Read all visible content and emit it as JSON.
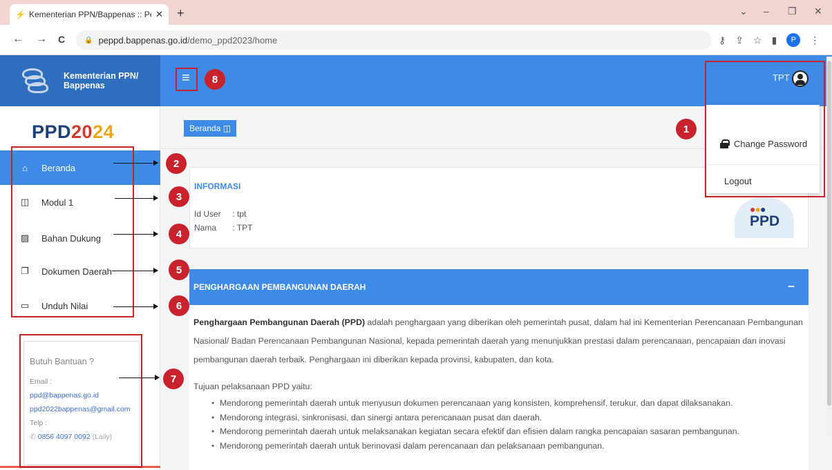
{
  "browser": {
    "tab_title": "Kementerian PPN/Bappenas :: Pe",
    "tab_close": "✕",
    "new_tab": "+",
    "url_domain": "peppd.bappenas.go.id",
    "url_path": "/demo_ppd2023/home",
    "profile_initial": "P",
    "controls": {
      "minimize": "–",
      "restore": "❐",
      "close": "✕",
      "chevron": "⌄"
    },
    "nav": {
      "back": "←",
      "forward": "→",
      "reload": "C"
    }
  },
  "header": {
    "brand_line1": "Kementerian PPN/",
    "brand_line2": "Bappenas",
    "menu_icon": "≡",
    "username": "TPT"
  },
  "user_menu": {
    "change_password": "Change Password",
    "logout": "Logout"
  },
  "sidebar": {
    "logo": {
      "part1": "PPD",
      "part2": "20",
      "part3": "24"
    },
    "items": [
      {
        "label": "Beranda",
        "icon": "home-icon",
        "glyph": "⌂"
      },
      {
        "label": "Modul 1",
        "icon": "book-icon",
        "glyph": "◫"
      },
      {
        "label": "Bahan Dukung",
        "icon": "document-icon",
        "glyph": "▨"
      },
      {
        "label": "Dokumen Daerah",
        "icon": "copy-icon",
        "glyph": "❐"
      },
      {
        "label": "Unduh Nilai",
        "icon": "monitor-icon",
        "glyph": "▭"
      }
    ],
    "help": {
      "title": "Butuh Bantuan ?",
      "email_label": "Email :",
      "email1": "ppd@bappenas.go.id",
      "email2": "ppd2022bappenas@gmail.com",
      "phone_label": "Telp :",
      "phone": "0856 4097 0092",
      "phone_note": "(Laily)"
    }
  },
  "main": {
    "breadcrumb": "Beranda",
    "breadcrumb_icon": "◫",
    "info": {
      "title": "INFORMASI",
      "id_user_label": "Id User",
      "id_user_value": ": tpt",
      "nama_label": "Nama",
      "nama_value": ": TPT",
      "badge_text": "PPD"
    },
    "section": {
      "title": "PENGHARGAAN PEMBANGUNAN DAERAH",
      "collapse": "–",
      "intro_bold": "Penghargaan Pembangunan Daerah (PPD)",
      "intro_rest": " adalah penghargaan yang diberikan oleh pemerintah pusat, dalam hal ini Kementerian Perencanaan Pembangunan Nasional/ Badan Perencanaan Pembangunan Nasional, kepada pemerintah daerah yang menunjukkan prestasi dalam perencanaan, pencapaian dan inovasi pembangunan daerah terbaik. Penghargaan ini diberikan kepada provinsi, kabupaten, dan kota.",
      "goals_label": "Tujuan pelaksanaan PPD yaitu:",
      "goals": [
        "Mendorong pemerintah daerah untuk menyusun dokumen perencanaan yang konsisten, komprehensif, terukur, dan dapat dilaksanakan.",
        "Mendorong integrasi, sinkronisasi, dan sinergi antara perencanaan pusat dan daerah.",
        "Mendorong pemerintah daerah untuk melaksanakan kegiatan secara efektif dan efisien dalam rangka pencapaian sasaran pembangunan.",
        "Mendorong pemerintah daerah untuk berinovasi dalam perencanaan dan pelaksanaan pembangunan."
      ]
    }
  },
  "annotations": [
    "1",
    "2",
    "3",
    "4",
    "5",
    "6",
    "7",
    "8"
  ],
  "colors": {
    "primary": "#3d8be6",
    "brand_dark": "#2f6fc0",
    "annotation": "#c8232c"
  }
}
